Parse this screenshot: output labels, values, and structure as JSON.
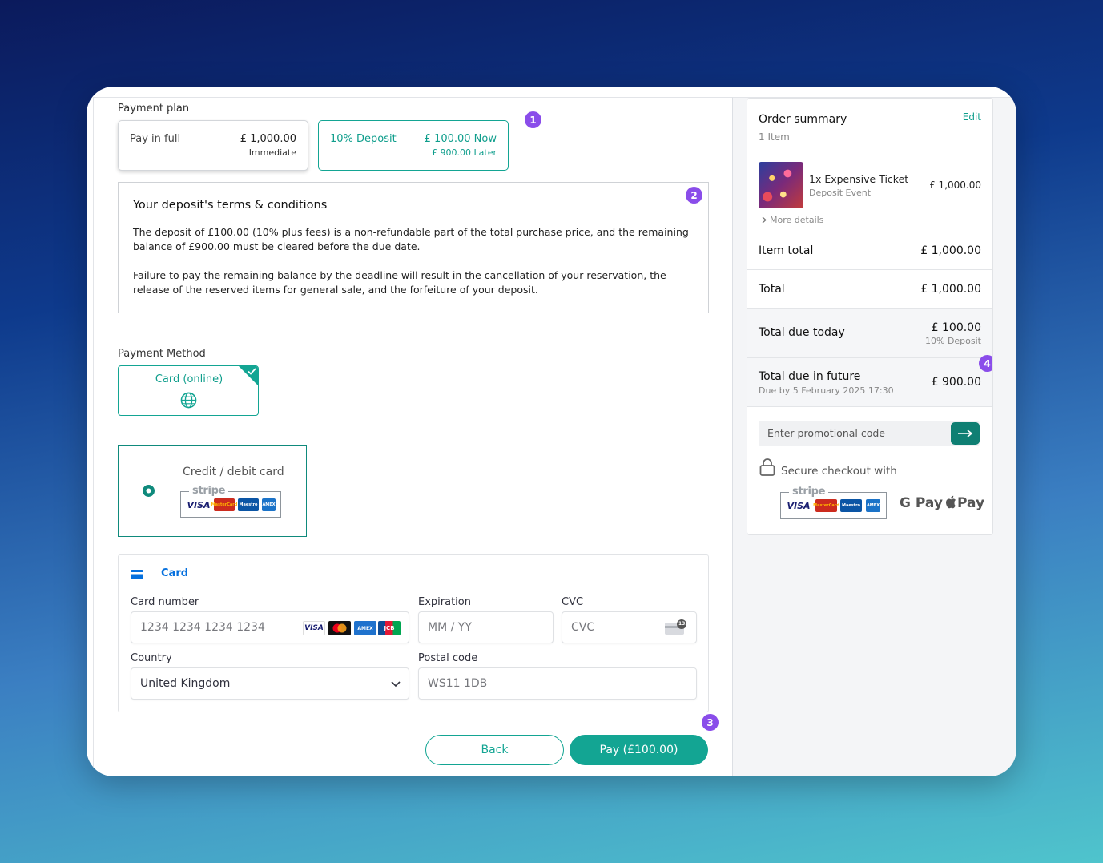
{
  "payment_plan": {
    "label": "Payment plan",
    "options": [
      {
        "name": "Pay in full",
        "amount": "£ 1,000.00",
        "sub": "Immediate"
      },
      {
        "name": "10% Deposit",
        "amount": "£ 100.00 Now",
        "sub": "£ 900.00 Later"
      }
    ]
  },
  "terms": {
    "title": "Your deposit's terms & conditions",
    "para1": "The deposit of £100.00 (10% plus fees) is a non-refundable part of the total purchase price, and the remaining balance of £900.00 must be cleared before the due date.",
    "para2": "Failure to pay the remaining balance by the deadline will result in the cancellation of your reservation, the release of the reserved items for general sale, and the forfeiture of your deposit."
  },
  "payment_method": {
    "label": "Payment Method",
    "option": "Card (online)",
    "credit_debit": "Credit / debit card",
    "stripe": "stripe"
  },
  "card_form": {
    "tab": "Card",
    "card_number_label": "Card number",
    "card_number_placeholder": "1234 1234 1234 1234",
    "expiration_label": "Expiration",
    "expiration_placeholder": "MM / YY",
    "cvc_label": "CVC",
    "cvc_placeholder": "CVC",
    "cvc_icon_text": "135",
    "country_label": "Country",
    "country_value": "United Kingdom",
    "postal_label": "Postal code",
    "postal_placeholder": "WS11 1DB"
  },
  "actions": {
    "back": "Back",
    "pay": "Pay (£100.00)"
  },
  "badges": [
    "1",
    "2",
    "3",
    "4"
  ],
  "logos": {
    "visa": "VISA",
    "mastercard": "MasterCard",
    "maestro": "Maestro",
    "amex": "AMEX",
    "jcb": "JCB",
    "gpay": "G Pay",
    "applepay": "Pay"
  },
  "summary": {
    "title": "Order summary",
    "edit": "Edit",
    "items_count": "1 Item",
    "item_name": "1x Expensive Ticket",
    "item_event": "Deposit Event",
    "item_price": "£ 1,000.00",
    "more_details": "More details",
    "item_total_label": "Item total",
    "item_total": "£ 1,000.00",
    "total_label": "Total",
    "total": "£ 1,000.00",
    "due_today_label": "Total due today",
    "due_today": "£ 100.00",
    "due_today_sub": "10% Deposit",
    "due_future_label": "Total due in future",
    "due_future_sub": "Due by 5 February 2025 17:30",
    "due_future": "£ 900.00",
    "promo_placeholder": "Enter promotional code",
    "secure": "Secure checkout with"
  },
  "colors": {
    "accent": "#13a593",
    "badge": "#8a4dea"
  }
}
